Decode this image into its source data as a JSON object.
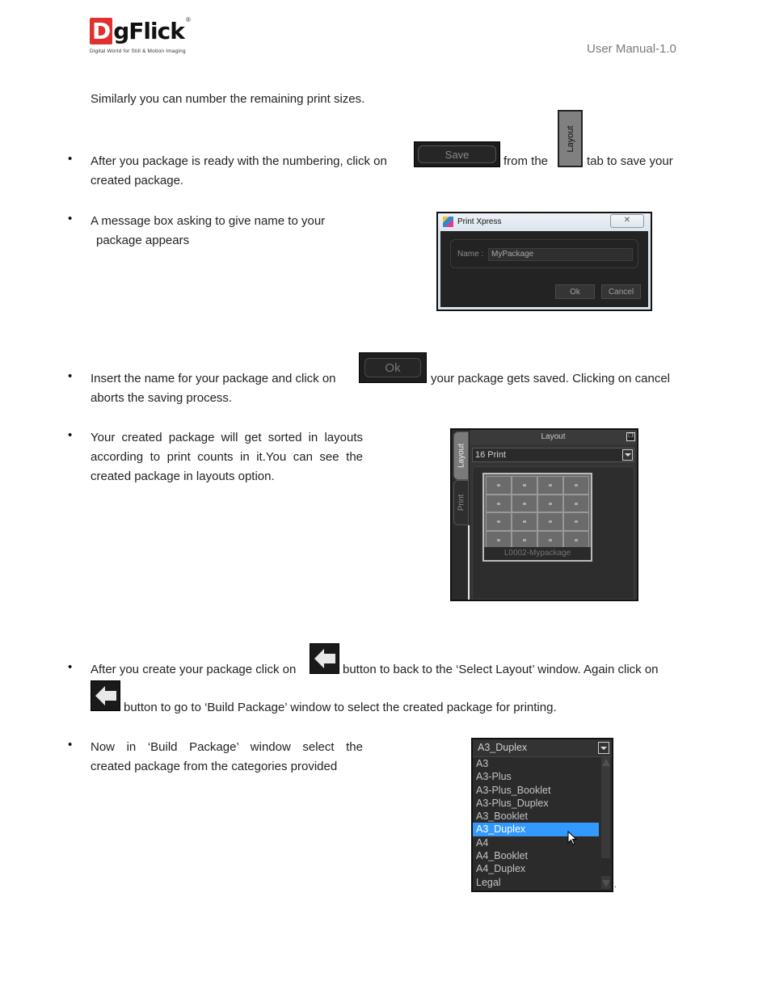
{
  "header": {
    "logo_text": "gFlick",
    "logo_letter": "D",
    "logo_registered": "®",
    "logo_tagline": "Digital World for Still & Motion Imaging",
    "doc_label": "User Manual-1.0"
  },
  "intro": "Similarly you can number the remaining print sizes.",
  "bullets": [
    {
      "part1": "After you package is ready with the numbering, click on",
      "part2": "from the",
      "part3": "tab to save your",
      "line2": "created package."
    },
    {
      "line1": "A message box asking to give name to your",
      "line2": "package appears"
    },
    {
      "part1": "Insert the name for your package and click on",
      "part2": "your package gets saved. Clicking on cancel",
      "line2": "aborts the saving process."
    },
    {
      "line1": "Your created package will get sorted in layouts",
      "line2": "according to print counts in it.You can see the",
      "line3": "created package in layouts option."
    },
    {
      "part1": "After you create your package click on",
      "part2": "button to back to the ‘Select Layout’ window. Again click on",
      "line2": "button to go to ‘Build Package’ window to select the created package for printing."
    },
    {
      "line1": "Now in ‘Build Package’ window select the",
      "line2": "created package from the categories provided"
    }
  ],
  "inline_buttons": {
    "save_label": "Save",
    "layout_tab_label": "Layout",
    "ok_label": "Ok"
  },
  "dialog": {
    "title": "Print Xpress",
    "close_glyph": "✕",
    "name_label": "Name :",
    "name_value": "MyPackage",
    "ok_label": "Ok",
    "cancel_label": "Cancel"
  },
  "layout_panel": {
    "title": "Layout",
    "tabs": [
      "Layout",
      "Print"
    ],
    "select_value": "16 Print",
    "restore_glyph": "❐",
    "thumbnail_caption": "L0002-Mypackage",
    "grid_rows": 4,
    "grid_cols": 4
  },
  "dropdown": {
    "selected_value": "A3_Duplex",
    "items": [
      "A3",
      "A3-Plus",
      "A3-Plus_Booklet",
      "A3-Plus_Duplex",
      "A3_Booklet",
      "A3_Duplex",
      "A4",
      "A4_Booklet",
      "A4_Duplex",
      "Legal"
    ],
    "highlighted_index": 5
  },
  "colors": {
    "logo_red": "#e03030",
    "selection_blue": "#3399ff",
    "dark_ui": "#232323"
  }
}
